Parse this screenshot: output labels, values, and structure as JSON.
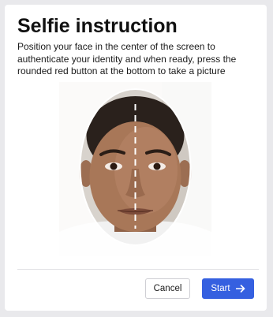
{
  "dialog": {
    "title": "Selfie instruction",
    "instructions": "Position your face in the center of the screen to authenticate your identity and when ready, press the rounded red button at the bottom to take a picture",
    "preview": {
      "icons": [
        "face-oval-guide-icon",
        "center-dashed-line-icon"
      ]
    },
    "buttons": {
      "cancel_label": "Cancel",
      "start_label": "Start",
      "start_icon": "arrow-right-icon"
    }
  },
  "colors": {
    "primary": "#3560e0",
    "background": "#e9e9ec",
    "surface": "#ffffff"
  }
}
